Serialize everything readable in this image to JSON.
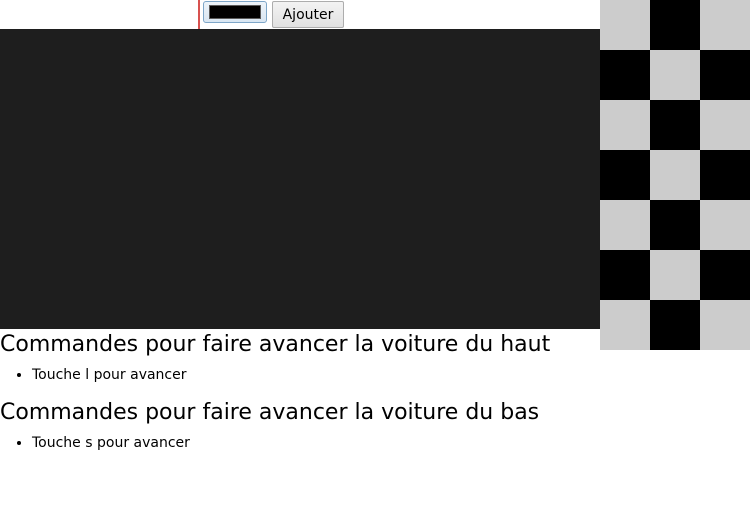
{
  "toolbar": {
    "color_value": "#000000",
    "add_label": "Ajouter"
  },
  "track": {
    "background": "#1e1e1e"
  },
  "checker": {
    "light": "#cccccc",
    "dark": "#000000"
  },
  "sections": [
    {
      "heading": "Commandes pour faire avancer la voiture du haut",
      "items": [
        "Touche l pour avancer"
      ]
    },
    {
      "heading": "Commandes pour faire avancer la voiture du bas",
      "items": [
        "Touche s pour avancer"
      ]
    }
  ]
}
